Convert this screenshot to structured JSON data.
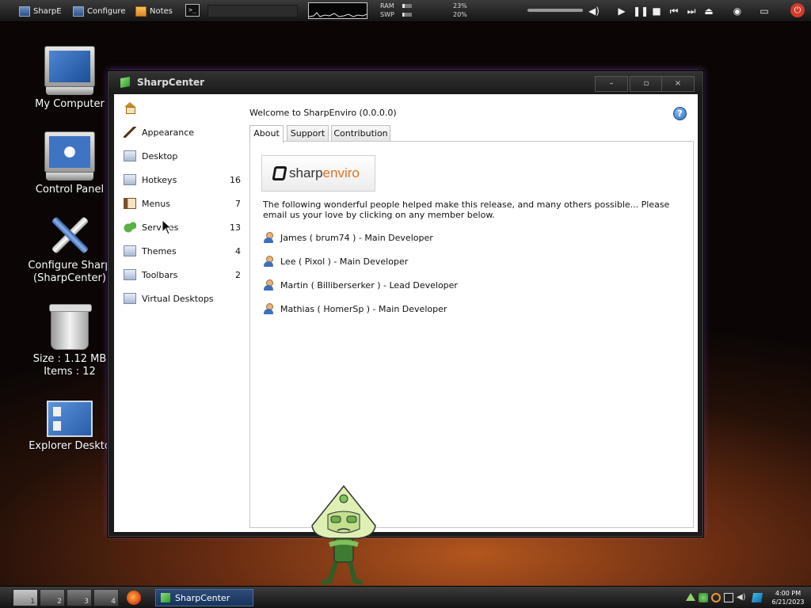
{
  "topbar": {
    "sharpe_label": "SharpE",
    "configure_label": "Configure",
    "notes_label": "Notes",
    "terminal_glyph": ">_",
    "ram_label": "RAM",
    "swp_label": "SWP",
    "ram_pct": "23%",
    "swp_pct": "20%",
    "ram_level": 0.23,
    "swp_level": 0.2
  },
  "desktop_icons": {
    "my_computer": "My Computer",
    "control_panel": "Control Panel",
    "configure_sharp_line1": "Configure Sharp",
    "configure_sharp_line2": "(SharpCenter)",
    "trash_size": "Size : 1.12 MB",
    "trash_items": "Items : 12",
    "explorer_desktop": "Explorer Deskto"
  },
  "window": {
    "title": "SharpCenter",
    "controls": {
      "minimize": "–",
      "maximize": "▫",
      "close": "×"
    },
    "sidebar": [
      {
        "label": "Appearance",
        "count": ""
      },
      {
        "label": "Desktop",
        "count": ""
      },
      {
        "label": "Hotkeys",
        "count": "16"
      },
      {
        "label": "Menus",
        "count": "7"
      },
      {
        "label": "Services",
        "count": "13"
      },
      {
        "label": "Themes",
        "count": "4"
      },
      {
        "label": "Toolbars",
        "count": "2"
      },
      {
        "label": "Virtual Desktops",
        "count": ""
      }
    ],
    "welcome": "Welcome to SharpEnviro (0.0.0.0)",
    "help_glyph": "?",
    "tabs": [
      "About",
      "Support",
      "Contribution"
    ],
    "logo": {
      "sharp": "sharp",
      "enviro": "enviro"
    },
    "intro": "The following wonderful people helped make this release, and many others possible... Please email us your love by clicking on any member below.",
    "members": [
      "James ( brum74 ) - Main Developer",
      "Lee ( Pixol ) - Main Developer",
      "Martin ( Billiberserker ) - Lead Developer",
      "Mathias ( HomerSp ) - Main Developer"
    ]
  },
  "taskbar": {
    "desktops": [
      "1",
      "2",
      "3",
      "4"
    ],
    "task_label": "SharpCenter",
    "time": "4:00 PM",
    "date": "6/21/2023"
  },
  "colors": {
    "accent_orange": "#e2711d",
    "active_task": "#2c4b78"
  }
}
